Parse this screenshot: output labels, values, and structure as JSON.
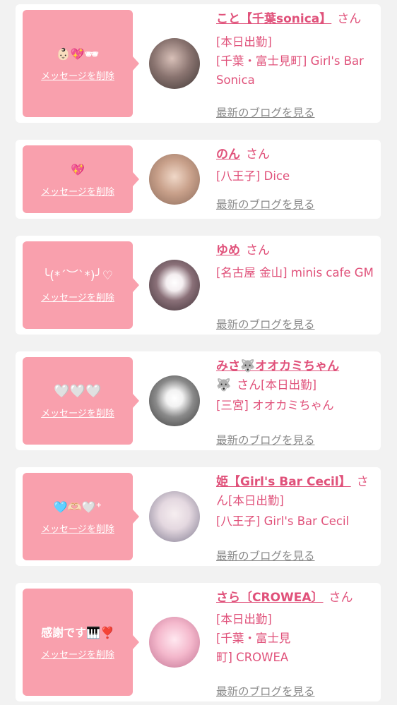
{
  "entries": [
    {
      "bubble": "👶🏻💖🕶",
      "delete_label": "メッセージを削除",
      "name": "こと【千葉sonica】",
      "san": "さん",
      "meta1": "[本日出勤]",
      "meta2": "[千葉・富士見町] Girl's Bar Sonica",
      "blog": "最新のブログを見る",
      "avatar_color": "#7a6a68"
    },
    {
      "bubble": "💖",
      "delete_label": "メッセージを削除",
      "name": "のん",
      "san": "さん",
      "meta1": "[八王子] Dice",
      "blog": "最新のブログを見る",
      "avatar_color": "#c8a89a"
    },
    {
      "bubble": "╰(*´︶`*)╯♡",
      "delete_label": "メッセージを削除",
      "name": "ゆめ",
      "san": "さん",
      "meta1": "[名古屋 金山] minis cafe GM",
      "blog": "最新のブログを見る",
      "avatar_color": "#6e5a62"
    },
    {
      "bubble": "🤍🤍🤍",
      "delete_label": "メッセージを削除",
      "name": "みさ🐺オオカミちゃん",
      "name_tail": "🐺",
      "san": "さん",
      "meta1": "[本日出勤]",
      "meta2": "[三宮] オオカミちゃん",
      "blog": "最新のブログを見る",
      "avatar_color": "#9a9a9a"
    },
    {
      "bubble": "🩵🫶🏻🤍⁺",
      "delete_label": "メッセージを削除",
      "name": "姫【Girl's Bar Cecil】",
      "san": "さん",
      "meta1": "[本日出勤]",
      "meta2": "[八王子] Girl's Bar Cecil",
      "blog": "最新のブログを見る",
      "avatar_color": "#e8e0e8"
    },
    {
      "bubble": "感謝です🎹❣️",
      "delete_label": "メッセージを削除",
      "name": "さら〔CROWEA〕",
      "san": "さん",
      "meta1": "[本日出勤]",
      "meta2": "[千葉・富士見",
      "meta3": "町] CROWEA",
      "blog": "最新のブログを見る",
      "avatar_color": "#f0a8c0"
    }
  ],
  "colors": {
    "accent": "#e0517a",
    "bubble": "#f9a0ad",
    "link_gray": "#8a8a8a"
  }
}
